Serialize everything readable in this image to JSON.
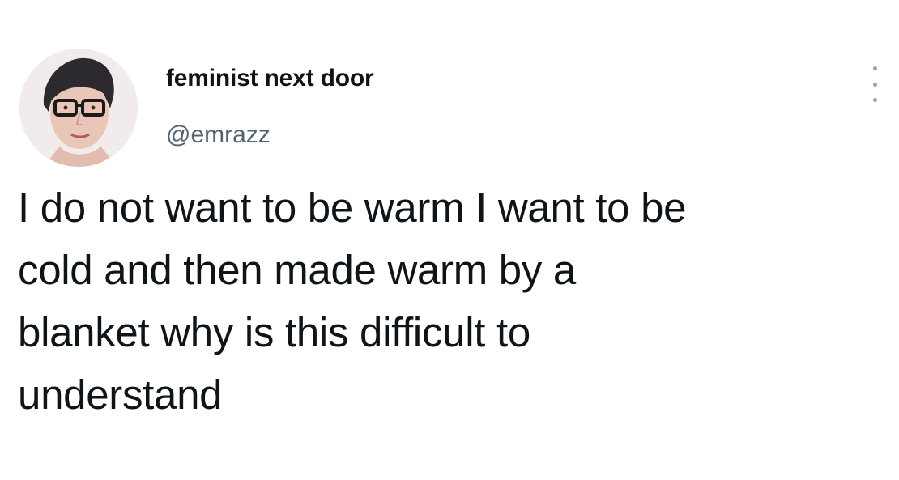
{
  "tweet": {
    "author": {
      "display_name": "feminist next door",
      "handle": "@emrazz",
      "avatar_icon": "profile-photo"
    },
    "more_icon": "vertical-ellipsis-icon",
    "text_lines": [
      "I do not want to be warm I want to be",
      "cold and then made warm by a",
      "blanket why is this difficult to",
      "understand"
    ]
  },
  "colors": {
    "background": "#ffffff",
    "primary_text": "#0f1419",
    "secondary_text": "#536471"
  }
}
